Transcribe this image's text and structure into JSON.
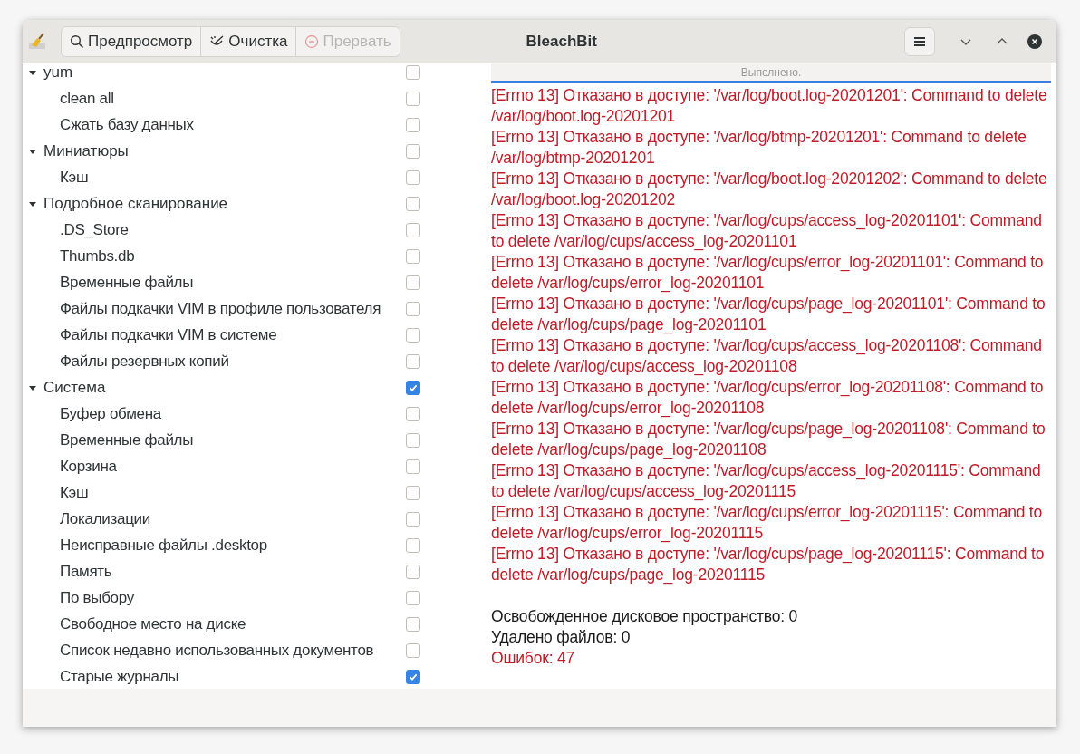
{
  "window": {
    "title": "BleachBit"
  },
  "toolbar": [
    {
      "label": "Предпросмотр",
      "kind": "search",
      "disabled": false
    },
    {
      "label": "Очистка",
      "kind": "clean",
      "disabled": false
    },
    {
      "label": "Прервать",
      "kind": "stop",
      "disabled": true
    }
  ],
  "tree": [
    {
      "label": "yum",
      "expanded": true,
      "checked": false,
      "children": [
        {
          "label": "clean all",
          "checked": false
        },
        {
          "label": "Сжать базу данных",
          "checked": false
        }
      ]
    },
    {
      "label": "Миниатюры",
      "expanded": true,
      "checked": false,
      "children": [
        {
          "label": "Кэш",
          "checked": false
        }
      ]
    },
    {
      "label": "Подробное сканирование",
      "expanded": true,
      "checked": false,
      "children": [
        {
          "label": ".DS_Store",
          "checked": false
        },
        {
          "label": "Thumbs.db",
          "checked": false
        },
        {
          "label": "Временные файлы",
          "checked": false
        },
        {
          "label": "Файлы подкачки VIM в профиле пользователя",
          "checked": false
        },
        {
          "label": "Файлы подкачки VIM в системе",
          "checked": false
        },
        {
          "label": "Файлы резервных копий",
          "checked": false
        }
      ]
    },
    {
      "label": "Система",
      "expanded": true,
      "checked": true,
      "children": [
        {
          "label": "Буфер обмена",
          "checked": false
        },
        {
          "label": "Временные файлы",
          "checked": false
        },
        {
          "label": "Корзина",
          "checked": false
        },
        {
          "label": "Кэш",
          "checked": false
        },
        {
          "label": "Локализации",
          "checked": false
        },
        {
          "label": "Неисправные файлы .desktop",
          "checked": false
        },
        {
          "label": "Память",
          "checked": false
        },
        {
          "label": "По выбору",
          "checked": false
        },
        {
          "label": "Свободное место на диске",
          "checked": false
        },
        {
          "label": "Список недавно использованных документов",
          "checked": false
        },
        {
          "label": "Старые журналы",
          "checked": true
        }
      ]
    }
  ],
  "progress": {
    "text": "Выполнено.",
    "level": 1
  },
  "log": [
    {
      "kind": "error",
      "text": "[Errno 13] Отказано в доступе: '/var/log/boot.log-20201201': Command to delete /var/log/boot.log-20201201"
    },
    {
      "kind": "error",
      "text": "[Errno 13] Отказано в доступе: '/var/log/btmp-20201201': Command to delete /var/log/btmp-20201201"
    },
    {
      "kind": "error",
      "text": "[Errno 13] Отказано в доступе: '/var/log/boot.log-20201202': Command to delete /var/log/boot.log-20201202"
    },
    {
      "kind": "error",
      "text": "[Errno 13] Отказано в доступе: '/var/log/cups/access_log-20201101': Command to delete /var/log/cups/access_log-20201101"
    },
    {
      "kind": "error",
      "text": "[Errno 13] Отказано в доступе: '/var/log/cups/error_log-20201101': Command to delete /var/log/cups/error_log-20201101"
    },
    {
      "kind": "error",
      "text": "[Errno 13] Отказано в доступе: '/var/log/cups/page_log-20201101': Command to delete /var/log/cups/page_log-20201101"
    },
    {
      "kind": "error",
      "text": "[Errno 13] Отказано в доступе: '/var/log/cups/access_log-20201108': Command to delete /var/log/cups/access_log-20201108"
    },
    {
      "kind": "error",
      "text": "[Errno 13] Отказано в доступе: '/var/log/cups/error_log-20201108': Command to delete /var/log/cups/error_log-20201108"
    },
    {
      "kind": "error",
      "text": "[Errno 13] Отказано в доступе: '/var/log/cups/page_log-20201108': Command to delete /var/log/cups/page_log-20201108"
    },
    {
      "kind": "error",
      "text": "[Errno 13] Отказано в доступе: '/var/log/cups/access_log-20201115': Command to delete /var/log/cups/access_log-20201115"
    },
    {
      "kind": "error",
      "text": "[Errno 13] Отказано в доступе: '/var/log/cups/error_log-20201115': Command to delete /var/log/cups/error_log-20201115"
    },
    {
      "kind": "error",
      "text": "[Errno 13] Отказано в доступе: '/var/log/cups/page_log-20201115': Command to delete /var/log/cups/page_log-20201115"
    },
    {
      "kind": "blank"
    },
    {
      "kind": "info",
      "text": "Освобожденное дисковое пространство: 0"
    },
    {
      "kind": "info",
      "text": "Удалено файлов: 0"
    },
    {
      "kind": "error",
      "text": "Ошибок: 47"
    }
  ]
}
